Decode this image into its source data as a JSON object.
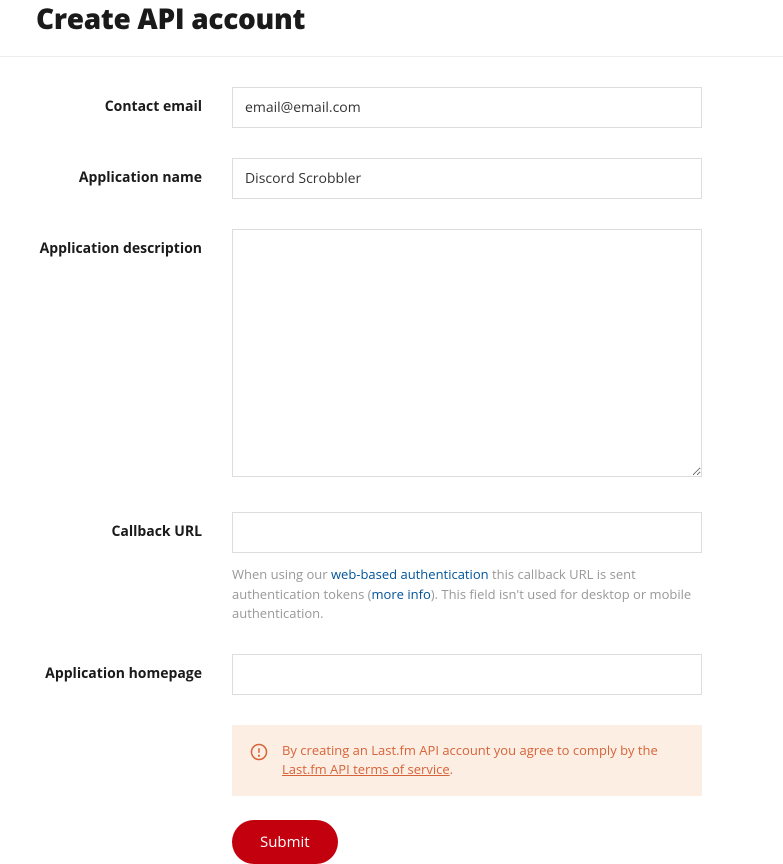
{
  "page": {
    "title": "Create API account"
  },
  "form": {
    "contact_email": {
      "label": "Contact email",
      "value": "email@email.com"
    },
    "application_name": {
      "label": "Application name",
      "value": "Discord Scrobbler"
    },
    "application_description": {
      "label": "Application description",
      "value": ""
    },
    "callback_url": {
      "label": "Callback URL",
      "value": "",
      "help_prefix": "When using our ",
      "help_link1": "web-based authentication",
      "help_mid": " this callback URL is sent authentication tokens (",
      "help_link2": "more info",
      "help_suffix": "). This field isn't used for desktop or mobile authentication."
    },
    "application_homepage": {
      "label": "Application homepage",
      "value": ""
    }
  },
  "notice": {
    "prefix": "By creating an Last.fm API account you agree to comply by the ",
    "link": "Last.fm API terms of service",
    "suffix": "."
  },
  "submit": {
    "label": "Submit"
  }
}
